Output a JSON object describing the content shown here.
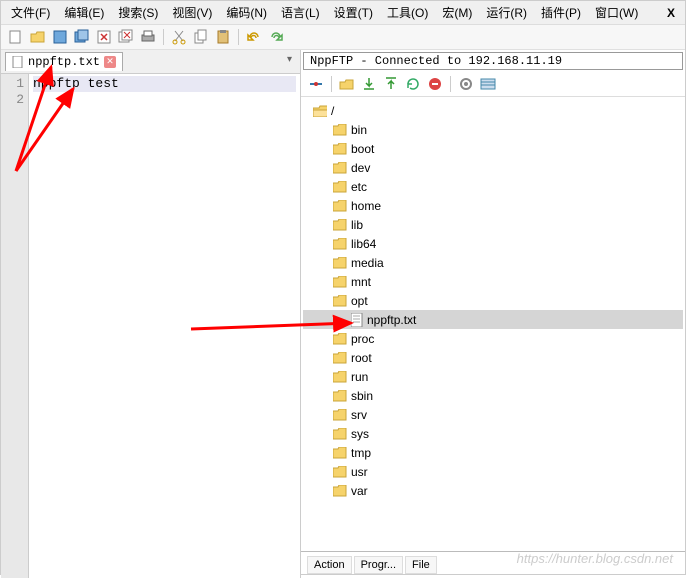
{
  "menu": {
    "file": "文件(F)",
    "edit": "编辑(E)",
    "search": "搜索(S)",
    "view": "视图(V)",
    "encoding": "编码(N)",
    "language": "语言(L)",
    "settings": "设置(T)",
    "tools": "工具(O)",
    "macro": "宏(M)",
    "run": "运行(R)",
    "plugins": "插件(P)",
    "window": "窗口(W)",
    "x": "X"
  },
  "tab": {
    "filename": "nppftp.txt"
  },
  "editor": {
    "line1": "nppftp test",
    "ln1": "1",
    "ln2": "2"
  },
  "ftp": {
    "title": "NppFTP - Connected to 192.168.11.19",
    "root": "/",
    "items": [
      "bin",
      "boot",
      "dev",
      "etc",
      "home",
      "lib",
      "lib64",
      "media",
      "mnt",
      "opt"
    ],
    "file": "nppftp.txt",
    "items2": [
      "proc",
      "root",
      "run",
      "sbin",
      "srv",
      "sys",
      "tmp",
      "usr",
      "var"
    ],
    "cols": {
      "action": "Action",
      "progress": "Progr...",
      "file": "File"
    }
  },
  "watermark": "https://hunter.blog.csdn.net"
}
